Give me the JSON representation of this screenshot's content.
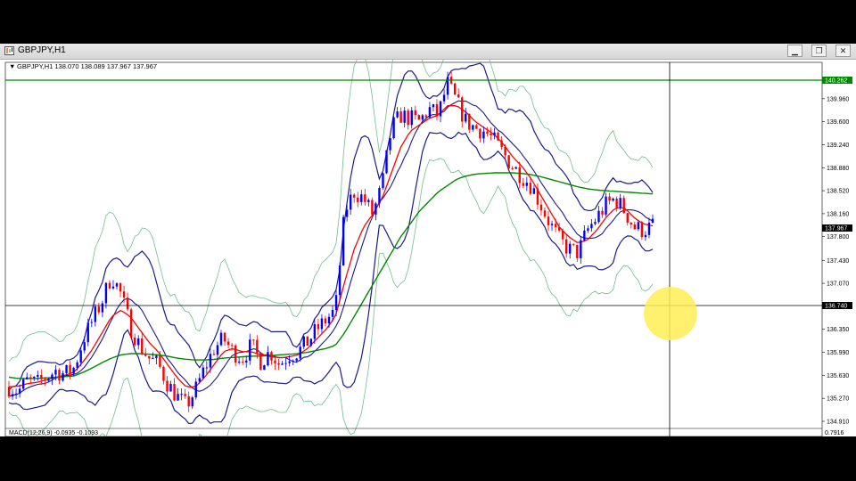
{
  "window": {
    "title": "GBPJPY,H1",
    "controls": {
      "minimize": "▁",
      "restore": "❐",
      "close": "✕"
    }
  },
  "chart_header": "GBPJPY,H1  138.070 138.089 137.967 137.967",
  "macd_label": "MACD(12,26,9) -0.0935 -0.1093",
  "macd_axis_value": "0.7916",
  "price_axis": {
    "ticks": [
      "139.960",
      "139.600",
      "139.240",
      "138.880",
      "138.520",
      "138.160",
      "137.800",
      "137.430",
      "137.070",
      "136.710",
      "136.350",
      "135.990",
      "135.630",
      "135.270",
      "134.910"
    ],
    "hline_upper": "140.262",
    "current_price": "137.967",
    "hline_lower": "136.740"
  },
  "colors": {
    "chart_bg": "#ffffff",
    "bull_candle": "#0000ff",
    "bear_candle": "#ff0000",
    "ma_fast": "#ff0000",
    "ma_mid": "#1a1a8c",
    "ma_slow": "#008800",
    "bollinger": "#6fbf8f",
    "hline_upper": "#008800",
    "hline_lower": "#000000",
    "cursor_highlight": "#ffee55"
  },
  "chart_data": {
    "type": "candlestick",
    "symbol": "GBPJPY",
    "timeframe": "H1",
    "ylim": [
      134.91,
      140.32
    ],
    "series": [
      {
        "name": "price_path",
        "values": [
          135.45,
          135.38,
          135.55,
          135.5,
          135.6,
          135.7,
          135.65,
          135.75,
          136.2,
          136.5,
          136.8,
          137.2,
          136.9,
          136.4,
          136.1,
          135.9,
          135.8,
          135.5,
          135.3,
          135.15,
          135.4,
          135.75,
          136.05,
          136.2,
          136.0,
          135.9,
          136.1,
          135.85,
          136.0,
          135.8,
          135.95,
          136.0,
          136.15,
          136.35,
          136.5,
          136.65,
          138.2,
          138.5,
          138.4,
          138.15,
          138.6,
          139.5,
          139.7,
          139.65,
          139.6,
          139.8,
          139.7,
          140.2,
          139.9,
          139.6,
          139.5,
          139.45,
          139.3,
          139.1,
          138.9,
          138.75,
          138.6,
          138.3,
          138.0,
          137.75,
          137.6,
          137.55,
          137.9,
          138.1,
          138.3,
          138.4,
          138.2,
          137.95,
          137.9,
          137.97
        ]
      },
      {
        "name": "ma_fast",
        "values": [
          135.45,
          135.46,
          135.5,
          135.52,
          135.56,
          135.6,
          135.63,
          135.68,
          135.85,
          136.05,
          136.3,
          136.55,
          136.65,
          136.55,
          136.35,
          136.15,
          136.0,
          135.8,
          135.6,
          135.45,
          135.45,
          135.6,
          135.8,
          136.0,
          136.05,
          136.0,
          136.0,
          135.95,
          135.95,
          135.9,
          135.92,
          135.95,
          136.05,
          136.2,
          136.35,
          136.55,
          137.1,
          137.6,
          137.95,
          138.15,
          138.4,
          138.8,
          139.2,
          139.45,
          139.55,
          139.65,
          139.7,
          139.85,
          139.85,
          139.75,
          139.6,
          139.5,
          139.4,
          139.25,
          139.05,
          138.9,
          138.7,
          138.45,
          138.2,
          137.95,
          137.8,
          137.7,
          137.75,
          137.9,
          138.1,
          138.25,
          138.25,
          138.1,
          138.0,
          137.97
        ]
      },
      {
        "name": "ma_slow",
        "values": [
          135.6,
          135.58,
          135.58,
          135.58,
          135.59,
          135.6,
          135.61,
          135.62,
          135.68,
          135.75,
          135.83,
          135.9,
          135.95,
          135.97,
          135.97,
          135.96,
          135.95,
          135.93,
          135.9,
          135.88,
          135.87,
          135.87,
          135.88,
          135.9,
          135.91,
          135.92,
          135.93,
          135.93,
          135.94,
          135.95,
          135.96,
          135.97,
          135.99,
          136.02,
          136.05,
          136.1,
          136.3,
          136.55,
          136.8,
          137.05,
          137.3,
          137.55,
          137.8,
          138.0,
          138.2,
          138.35,
          138.5,
          138.6,
          138.7,
          138.75,
          138.78,
          138.79,
          138.8,
          138.8,
          138.8,
          138.79,
          138.77,
          138.74,
          138.7,
          138.66,
          138.62,
          138.58,
          138.55,
          138.53,
          138.52,
          138.51,
          138.5,
          138.49,
          138.48,
          138.47
        ]
      }
    ]
  }
}
